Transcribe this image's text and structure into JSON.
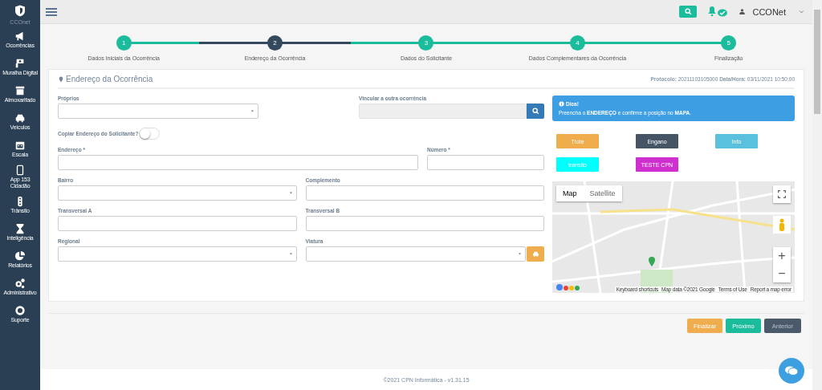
{
  "sidebar": {
    "logo_text": "CCOnet",
    "items": [
      {
        "label": "Ocorrências"
      },
      {
        "label": "Muralha Digital"
      },
      {
        "label": "Almoxarifado"
      },
      {
        "label": "Veículos"
      },
      {
        "label": "Escala"
      },
      {
        "label": "App 153 Cidadão"
      },
      {
        "label": "Trânsito"
      },
      {
        "label": "Inteligência"
      },
      {
        "label": "Relatórios"
      },
      {
        "label": "Administrativo"
      },
      {
        "label": "Suporte"
      }
    ]
  },
  "topbar": {
    "user": "CCONet"
  },
  "steps": [
    {
      "number": "1",
      "label": "Dados Iniciais da Ocorrência",
      "selected": false
    },
    {
      "number": "2",
      "label": "Endereço da Ocorrência",
      "selected": true
    },
    {
      "number": "3",
      "label": "Dados do Solicitante",
      "selected": false
    },
    {
      "number": "4",
      "label": "Dados Complementares da Ocorrência",
      "selected": false
    },
    {
      "number": "5",
      "label": "Finalização",
      "selected": false
    }
  ],
  "card": {
    "title": "Endereço da Ocorrência",
    "protocol": "**Protocolo:** 20211103105000 **Data/Hora:** 03/11/2021 10:50:00"
  },
  "form_rows": [
    [
      {
        "label": "Próprios",
        "kind": "select"
      },
      {
        "label": "Vincular a outra ocorrência",
        "kind": "search"
      }
    ],
    [
      {
        "label": "Copiar Endereço do Solicitante?",
        "kind": "switch",
        "on": false
      }
    ],
    [
      {
        "label": "Endereço *",
        "kind": "text"
      },
      {
        "label": "Número *",
        "kind": "text"
      }
    ],
    [
      {
        "label": "Bairro",
        "kind": "select"
      },
      {
        "label": "Complemento",
        "kind": "text"
      }
    ],
    [
      {
        "label": "Transversal A",
        "kind": "text"
      },
      {
        "label": "Transversal B",
        "kind": "text"
      }
    ],
    [
      {
        "label": "Regional",
        "kind": "select"
      },
      {
        "label": "Viatura",
        "kind": "select-car"
      }
    ]
  ],
  "tip": {
    "title": "Dica!",
    "text": "Preencha o **ENDEREÇO** e confirme a posição no **MAPA**."
  },
  "quick_buttons": [
    {
      "label": "Trote",
      "color": "#f0ad4e"
    },
    {
      "label": "Engano",
      "color": "#465566"
    },
    {
      "label": "Info",
      "color": "#5bc0de"
    },
    {
      "label": "transito",
      "color": "#00ffff"
    },
    {
      "label": "TESTE CPN",
      "color": "#d02fd0"
    }
  ],
  "map": {
    "map_types": [
      {
        "label": "Map",
        "selected": true
      },
      {
        "label": "Satellite",
        "selected": false
      }
    ],
    "zoom_in": "+",
    "zoom_out": "−",
    "attribution": [
      "Keyboard shortcuts",
      "Map data ©2021 Google",
      "Terms of Use",
      "Report a map error"
    ]
  },
  "actions": [
    {
      "label": "Finalizar",
      "color": "#f0ad4e",
      "disabled": false
    },
    {
      "label": "Próximo",
      "color": "#1abc9c",
      "disabled": false
    },
    {
      "label": "Anterior",
      "color": "#4a5a6b",
      "disabled": true
    }
  ],
  "footer": "©2021 CPN Informática - v1.31.15"
}
